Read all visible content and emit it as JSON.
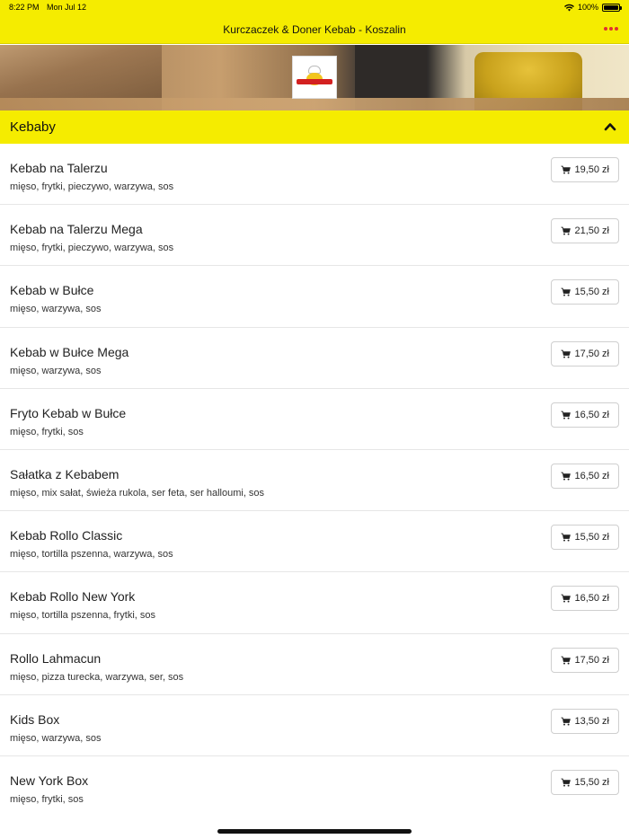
{
  "status_bar": {
    "time": "8:22 PM",
    "date": "Mon Jul 12",
    "battery": "100%",
    "battery_level": 1.0
  },
  "nav": {
    "title": "Kurczaczek & Doner Kebab - Koszalin"
  },
  "section": {
    "title": "Kebaby"
  },
  "currency_icon": "cart-icon",
  "accent_color": "#f5ec00",
  "menu": [
    {
      "name": "Kebab na Talerzu",
      "description": "mięso, frytki, pieczywo, warzywa, sos",
      "price": "19,50 zł"
    },
    {
      "name": "Kebab na Talerzu Mega",
      "description": "mięso, frytki, pieczywo, warzywa, sos",
      "price": "21,50 zł"
    },
    {
      "name": "Kebab w Bułce",
      "description": "mięso, warzywa, sos",
      "price": "15,50 zł"
    },
    {
      "name": "Kebab w Bułce Mega",
      "description": "mięso, warzywa, sos",
      "price": "17,50 zł"
    },
    {
      "name": "Fryto Kebab w Bułce",
      "description": "mięso, frytki, sos",
      "price": "16,50 zł"
    },
    {
      "name": "Sałatka z Kebabem",
      "description": "mięso, mix sałat, świeża rukola, ser feta, ser halloumi, sos",
      "price": "16,50 zł"
    },
    {
      "name": "Kebab Rollo Classic",
      "description": "mięso, tortilla pszenna, warzywa, sos",
      "price": "15,50 zł"
    },
    {
      "name": "Kebab Rollo New York",
      "description": "mięso, tortilla pszenna, frytki, sos",
      "price": "16,50 zł"
    },
    {
      "name": "Rollo Lahmacun",
      "description": "mięso, pizza turecka, warzywa, ser, sos",
      "price": "17,50 zł"
    },
    {
      "name": "Kids Box",
      "description": "mięso, warzywa, sos",
      "price": "13,50 zł"
    },
    {
      "name": "New York Box",
      "description": "mięso, frytki, sos",
      "price": "15,50 zł"
    }
  ]
}
